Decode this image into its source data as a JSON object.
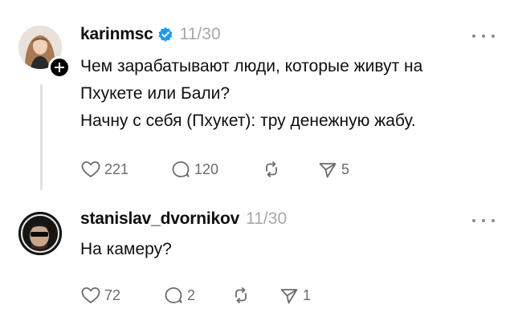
{
  "posts": [
    {
      "username": "karinmsc",
      "verified": true,
      "time": "11/30",
      "avatar_icon": "profile-photo-woman",
      "lines": [
        "Чем зарабатывают люди, которые живут на",
        "Пхукете или Бали?",
        "Начну с себя (Пхукет): тру денежную жабу."
      ],
      "likes": "221",
      "replies": "120",
      "shares": "5"
    },
    {
      "username": "stanislav_dvornikov",
      "verified": false,
      "time": "11/30",
      "avatar_icon": "profile-photo-man-sunglasses",
      "lines": [
        "На камеру?"
      ],
      "likes": "72",
      "replies": "2",
      "shares": "1"
    }
  ],
  "colors": {
    "verified": "#1d9bf0",
    "muted": "#a8a8a8",
    "icon": "#6b6b6b"
  }
}
